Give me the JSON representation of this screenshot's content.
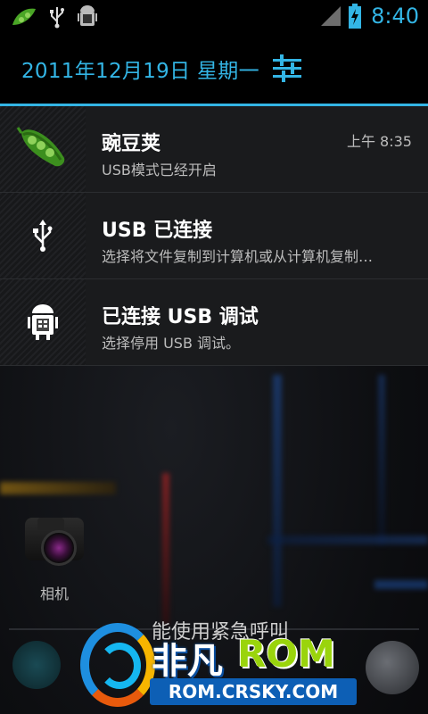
{
  "status_bar": {
    "time": "8:40",
    "icons": [
      "wandoujia-pea-icon",
      "usb-icon",
      "android-debug-icon",
      "signal-icon",
      "battery-charging-icon"
    ]
  },
  "shade": {
    "date": "2011年12月19日 星期一",
    "settings_icon": "settings-sliders-icon"
  },
  "notifications": [
    {
      "app": "豌豆荚",
      "text": "USB模式已经开启",
      "time": "上午 8:35",
      "icon": "pea-pod-icon"
    },
    {
      "app": "USB 已连接",
      "text": "选择将文件复制到计算机或从计算机复制…",
      "icon": "usb-icon"
    },
    {
      "app": "已连接 USB 调试",
      "text": "选择停用 USB 调试。",
      "icon": "android-debug-icon"
    }
  ],
  "background": {
    "camera_label": "相机",
    "emergency_call": "能使用紧急呼叫"
  },
  "watermark": {
    "brand_cn": "非凡",
    "brand_rom": "ROM",
    "domain": "ROM.CRSKY.COM"
  },
  "colors": {
    "accent": "#33b5e5",
    "notif_bg": "#1a1b1d",
    "status_bg": "#000000"
  }
}
